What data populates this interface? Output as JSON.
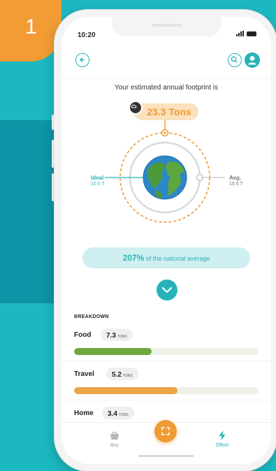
{
  "step": {
    "number": "1"
  },
  "status_bar": {
    "time": "10:20"
  },
  "header": {
    "back_icon": "arrow-left-icon",
    "search_icon": "search-icon",
    "profile_icon": "user-icon"
  },
  "footprint": {
    "headline": "Your estimated annual footprint is",
    "value": "23.3 Tons"
  },
  "comparison": {
    "ideal_label": "Ideal",
    "ideal_value": "10.5 T",
    "avg_label": "Avg.",
    "avg_value": "15.5 T"
  },
  "national": {
    "percent": "207%",
    "text": "of the national average"
  },
  "breakdown": {
    "title": "BREAKDOWN",
    "items": [
      {
        "name": "Food",
        "value": "7.3",
        "unit": "TONS",
        "fraction": 0.42,
        "color": "#6ea73d"
      },
      {
        "name": "Travel",
        "value": "5.2",
        "unit": "TONS",
        "fraction": 0.56,
        "color": "#e9a445"
      },
      {
        "name": "Home",
        "value": "3.4",
        "unit": "TONS"
      }
    ]
  },
  "tabbar": {
    "items": [
      {
        "label": "Buy",
        "icon": "basket-icon"
      },
      {
        "label": "",
        "icon": "scan-icon"
      },
      {
        "label": "Offset",
        "icon": "lightning-icon"
      }
    ]
  },
  "colors": {
    "accent": "#26b3b8",
    "orange": "#ef9a34",
    "background": "#1cb8c0"
  }
}
